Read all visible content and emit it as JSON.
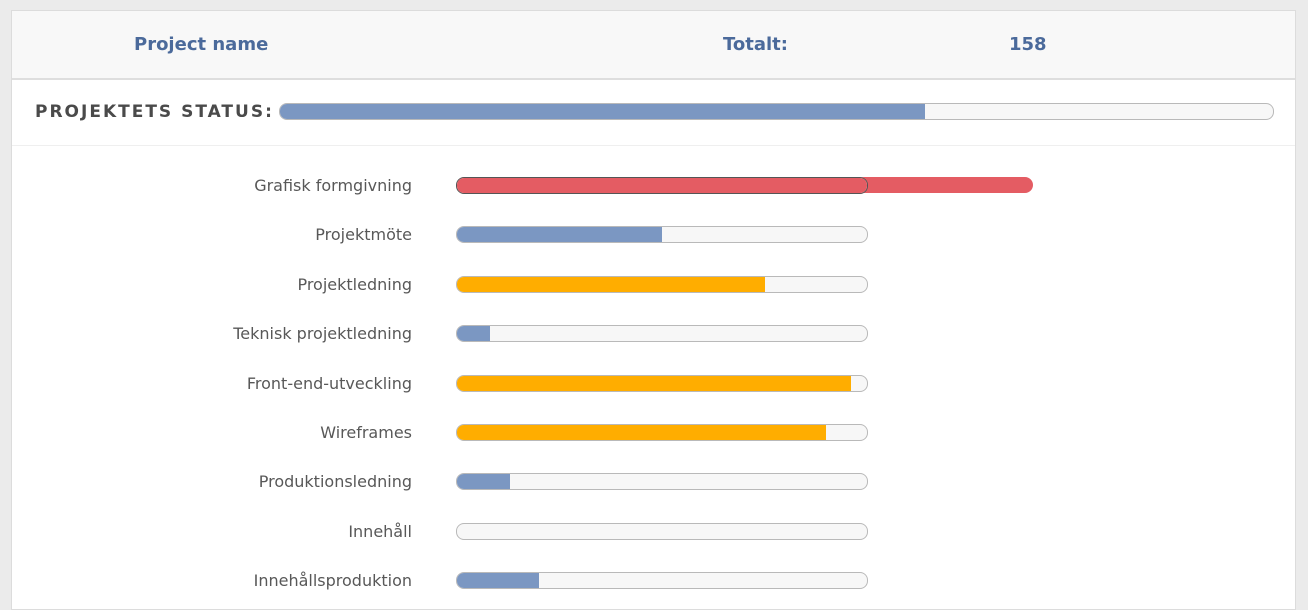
{
  "header": {
    "project_name_label": "Project name",
    "total_label": "Totalt:",
    "total_value": "158"
  },
  "status": {
    "label": "PROJEKTETS STATUS:",
    "progress": 0.65,
    "color": "#7b97c2"
  },
  "colors": {
    "blue": "#7b97c2",
    "orange": "#ffad00",
    "red": "#e45c63",
    "track": "#f7f7f7"
  },
  "items": [
    {
      "label": "Grafisk formgivning",
      "progress": 1.4,
      "color": "#e45c63"
    },
    {
      "label": "Projektmöte",
      "progress": 0.5,
      "color": "#7b97c2"
    },
    {
      "label": "Projektledning",
      "progress": 0.75,
      "color": "#ffad00"
    },
    {
      "label": "Teknisk projektledning",
      "progress": 0.08,
      "color": "#7b97c2"
    },
    {
      "label": "Front-end-utveckling",
      "progress": 0.96,
      "color": "#ffad00"
    },
    {
      "label": "Wireframes",
      "progress": 0.9,
      "color": "#ffad00"
    },
    {
      "label": "Produktionsledning",
      "progress": 0.13,
      "color": "#7b97c2"
    },
    {
      "label": "Innehåll",
      "progress": 0,
      "color": "#7b97c2"
    },
    {
      "label": "Innehållsproduktion",
      "progress": 0.2,
      "color": "#7b97c2"
    }
  ]
}
